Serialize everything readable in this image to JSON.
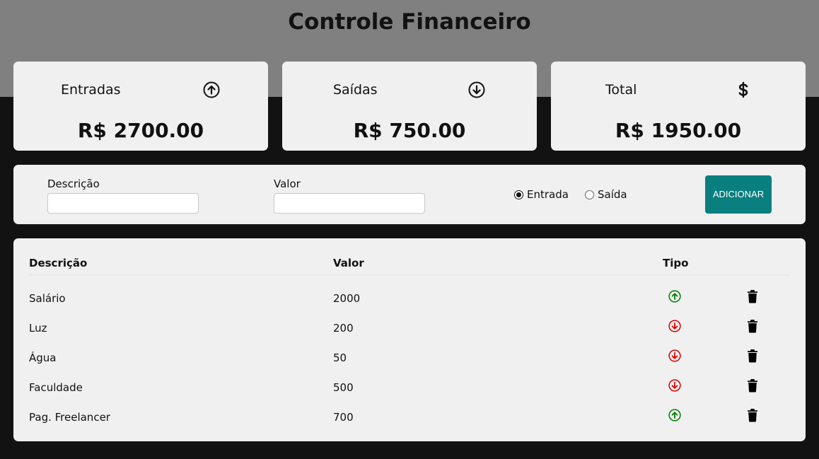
{
  "header": {
    "title": "Controle Financeiro"
  },
  "summary": {
    "income": {
      "label": "Entradas",
      "value": "R$ 2700.00",
      "icon": "arrow-up-circle-icon"
    },
    "expense": {
      "label": "Saídas",
      "value": "R$ 750.00",
      "icon": "arrow-down-circle-icon"
    },
    "total": {
      "label": "Total",
      "value": "R$ 1950.00",
      "icon": "dollar-icon"
    }
  },
  "form": {
    "description_label": "Descrição",
    "description_value": "",
    "value_label": "Valor",
    "value_value": "",
    "radio_income_label": "Entrada",
    "radio_expense_label": "Saída",
    "selected_type": "Entrada",
    "add_button_label": "ADICIONAR"
  },
  "table": {
    "columns": [
      "Descrição",
      "Valor",
      "Tipo"
    ],
    "rows": [
      {
        "description": "Salário",
        "value": "2000",
        "type": "income"
      },
      {
        "description": "Luz",
        "value": "200",
        "type": "expense"
      },
      {
        "description": "Água",
        "value": "50",
        "type": "expense"
      },
      {
        "description": "Faculdade",
        "value": "500",
        "type": "expense"
      },
      {
        "description": "Pag. Freelancer",
        "value": "700",
        "type": "income"
      }
    ]
  },
  "colors": {
    "income": "#008000",
    "expense": "#e00000",
    "accent": "#0a7f7f",
    "header_band": "#808080",
    "background": "#121212",
    "panel": "#f0f0f0"
  }
}
